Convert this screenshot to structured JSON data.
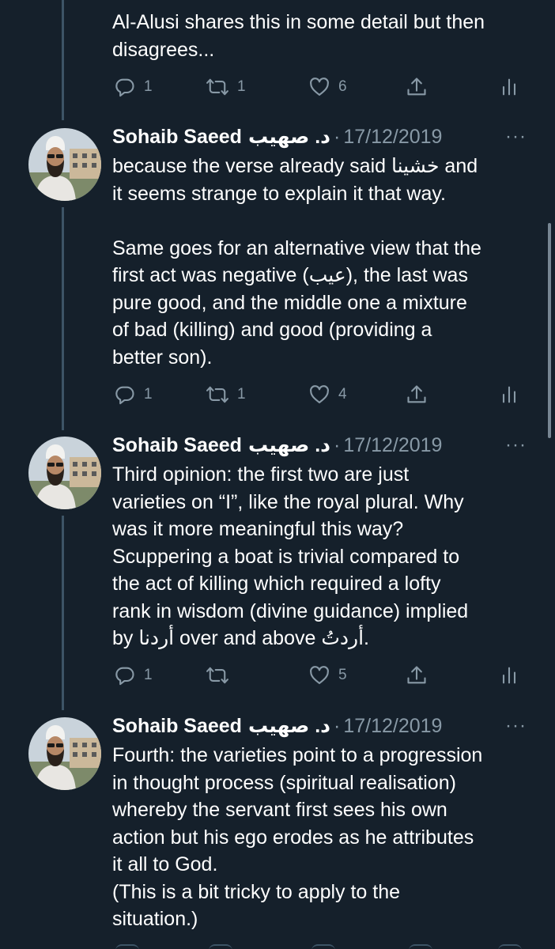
{
  "colors": {
    "background": "#15202b",
    "primary_text": "#ffffff",
    "secondary_text": "#8899a6",
    "thread_line": "#3d5466"
  },
  "icons": {
    "reply": "speech-bubble",
    "retweet": "retweet-arrows",
    "like": "heart",
    "share": "share-arrow-up",
    "analytics": "bar-chart",
    "more": "horizontal-ellipsis"
  },
  "tweets": [
    {
      "text": "Al-Alusi shares this in some detail but then\ndisagrees...",
      "actions": {
        "reply": "1",
        "retweet": "1",
        "like": "6"
      }
    },
    {
      "author": "Sohaib Saeed",
      "author_ar": "د. صهيب",
      "separator": "·",
      "date": "17/12/2019",
      "more": "···",
      "text_1": "because the verse already said خشينا and\nit seems strange to explain it that way.",
      "text_2": "Same goes for an alternative view that the\nfirst act was negative (عيب), the last was\npure good, and the middle one a mixture\nof bad (killing) and good (providing a\nbetter son).",
      "actions": {
        "reply": "1",
        "retweet": "1",
        "like": "4"
      }
    },
    {
      "author": "Sohaib Saeed",
      "author_ar": "د. صهيب",
      "separator": "·",
      "date": "17/12/2019",
      "more": "···",
      "text": "Third opinion: the first two are just\nvarieties on “I”, like the royal plural. Why\nwas it more meaningful this way?\nScuppering a boat is trivial compared to\nthe act of killing which required a lofty\nrank in wisdom (divine guidance) implied\nby أردنا over and above أردتُ.",
      "actions": {
        "reply": "1",
        "retweet": "",
        "like": "5"
      }
    },
    {
      "author": "Sohaib Saeed",
      "author_ar": "د. صهيب",
      "separator": "·",
      "date": "17/12/2019",
      "more": "···",
      "text": "Fourth: the varieties point to a progression\nin thought process (spiritual realisation)\nwhereby the servant first sees his own\naction but his ego erodes as he attributes\nit all to God.\n(This is a bit tricky to apply to the\nsituation.)"
    }
  ]
}
